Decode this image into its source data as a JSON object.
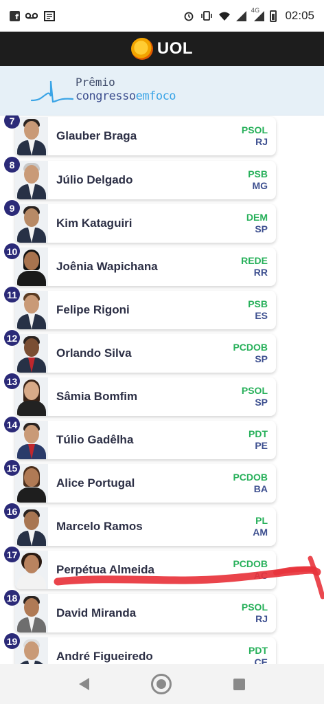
{
  "status_bar": {
    "time": "02:05",
    "network_label": "4G",
    "left_icons": [
      "facebook-icon",
      "voicemail-icon",
      "news-icon"
    ],
    "right_icons": [
      "alarm-icon",
      "vibrate-icon",
      "wifi-icon",
      "signal-icon",
      "signal-4g-icon",
      "battery-icon"
    ]
  },
  "header": {
    "brand": "UOL"
  },
  "banner": {
    "title": "Prêmio",
    "subtitle_main": "congresso",
    "subtitle_accent": "emfoco"
  },
  "colors": {
    "rank_badge": "#2b2a78",
    "party": "#27b05a",
    "state": "#3d4f8f",
    "annotation": "#e8343c"
  },
  "ranking": [
    {
      "rank": "7",
      "name": "Glauber Braga",
      "party": "PSOL",
      "state": "RJ"
    },
    {
      "rank": "8",
      "name": "Júlio Delgado",
      "party": "PSB",
      "state": "MG"
    },
    {
      "rank": "9",
      "name": "Kim Kataguiri",
      "party": "DEM",
      "state": "SP"
    },
    {
      "rank": "10",
      "name": "Joênia Wapichana",
      "party": "REDE",
      "state": "RR"
    },
    {
      "rank": "11",
      "name": "Felipe Rigoni",
      "party": "PSB",
      "state": "ES"
    },
    {
      "rank": "12",
      "name": "Orlando Silva",
      "party": "PCDOB",
      "state": "SP"
    },
    {
      "rank": "13",
      "name": "Sâmia Bomfim",
      "party": "PSOL",
      "state": "SP"
    },
    {
      "rank": "14",
      "name": "Túlio Gadêlha",
      "party": "PDT",
      "state": "PE"
    },
    {
      "rank": "15",
      "name": "Alice Portugal",
      "party": "PCDOB",
      "state": "BA"
    },
    {
      "rank": "16",
      "name": "Marcelo Ramos",
      "party": "PL",
      "state": "AM"
    },
    {
      "rank": "17",
      "name": "Perpétua Almeida",
      "party": "PCDOB",
      "state": "AC"
    },
    {
      "rank": "18",
      "name": "David Miranda",
      "party": "PSOL",
      "state": "RJ"
    },
    {
      "rank": "19",
      "name": "André Figueiredo",
      "party": "PDT",
      "state": "CE"
    }
  ],
  "nav_bar": {
    "buttons": [
      "back-icon",
      "home-icon",
      "recents-icon"
    ]
  }
}
